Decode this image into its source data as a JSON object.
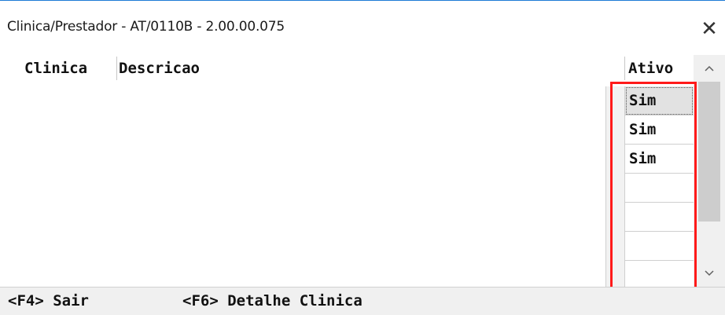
{
  "window": {
    "title": "Clinica/Prestador - AT/0110B - 2.00.00.075",
    "close_glyph": "✕"
  },
  "grid": {
    "columns": [
      "Clinica",
      "Descricao",
      "Ativo"
    ],
    "rows": [
      {
        "clinica": "",
        "descricao": "",
        "ativo": "Sim"
      },
      {
        "clinica": "",
        "descricao": "",
        "ativo": "Sim"
      },
      {
        "clinica": "",
        "descricao": "",
        "ativo": "Sim"
      },
      {
        "clinica": "",
        "descricao": "",
        "ativo": ""
      },
      {
        "clinica": "",
        "descricao": "",
        "ativo": ""
      },
      {
        "clinica": "",
        "descricao": "",
        "ativo": ""
      },
      {
        "clinica": "",
        "descricao": "",
        "ativo": ""
      }
    ],
    "selected_row": 0
  },
  "scrollbar": {
    "up_icon": "chevron-up-icon",
    "down_icon": "chevron-down-icon"
  },
  "statusbar": {
    "keys": [
      "<F4> Sair",
      "<F6> Detalhe Clinica"
    ]
  },
  "colors": {
    "highlight": "#ff1a1a",
    "title_border": "#1e7bd6"
  }
}
